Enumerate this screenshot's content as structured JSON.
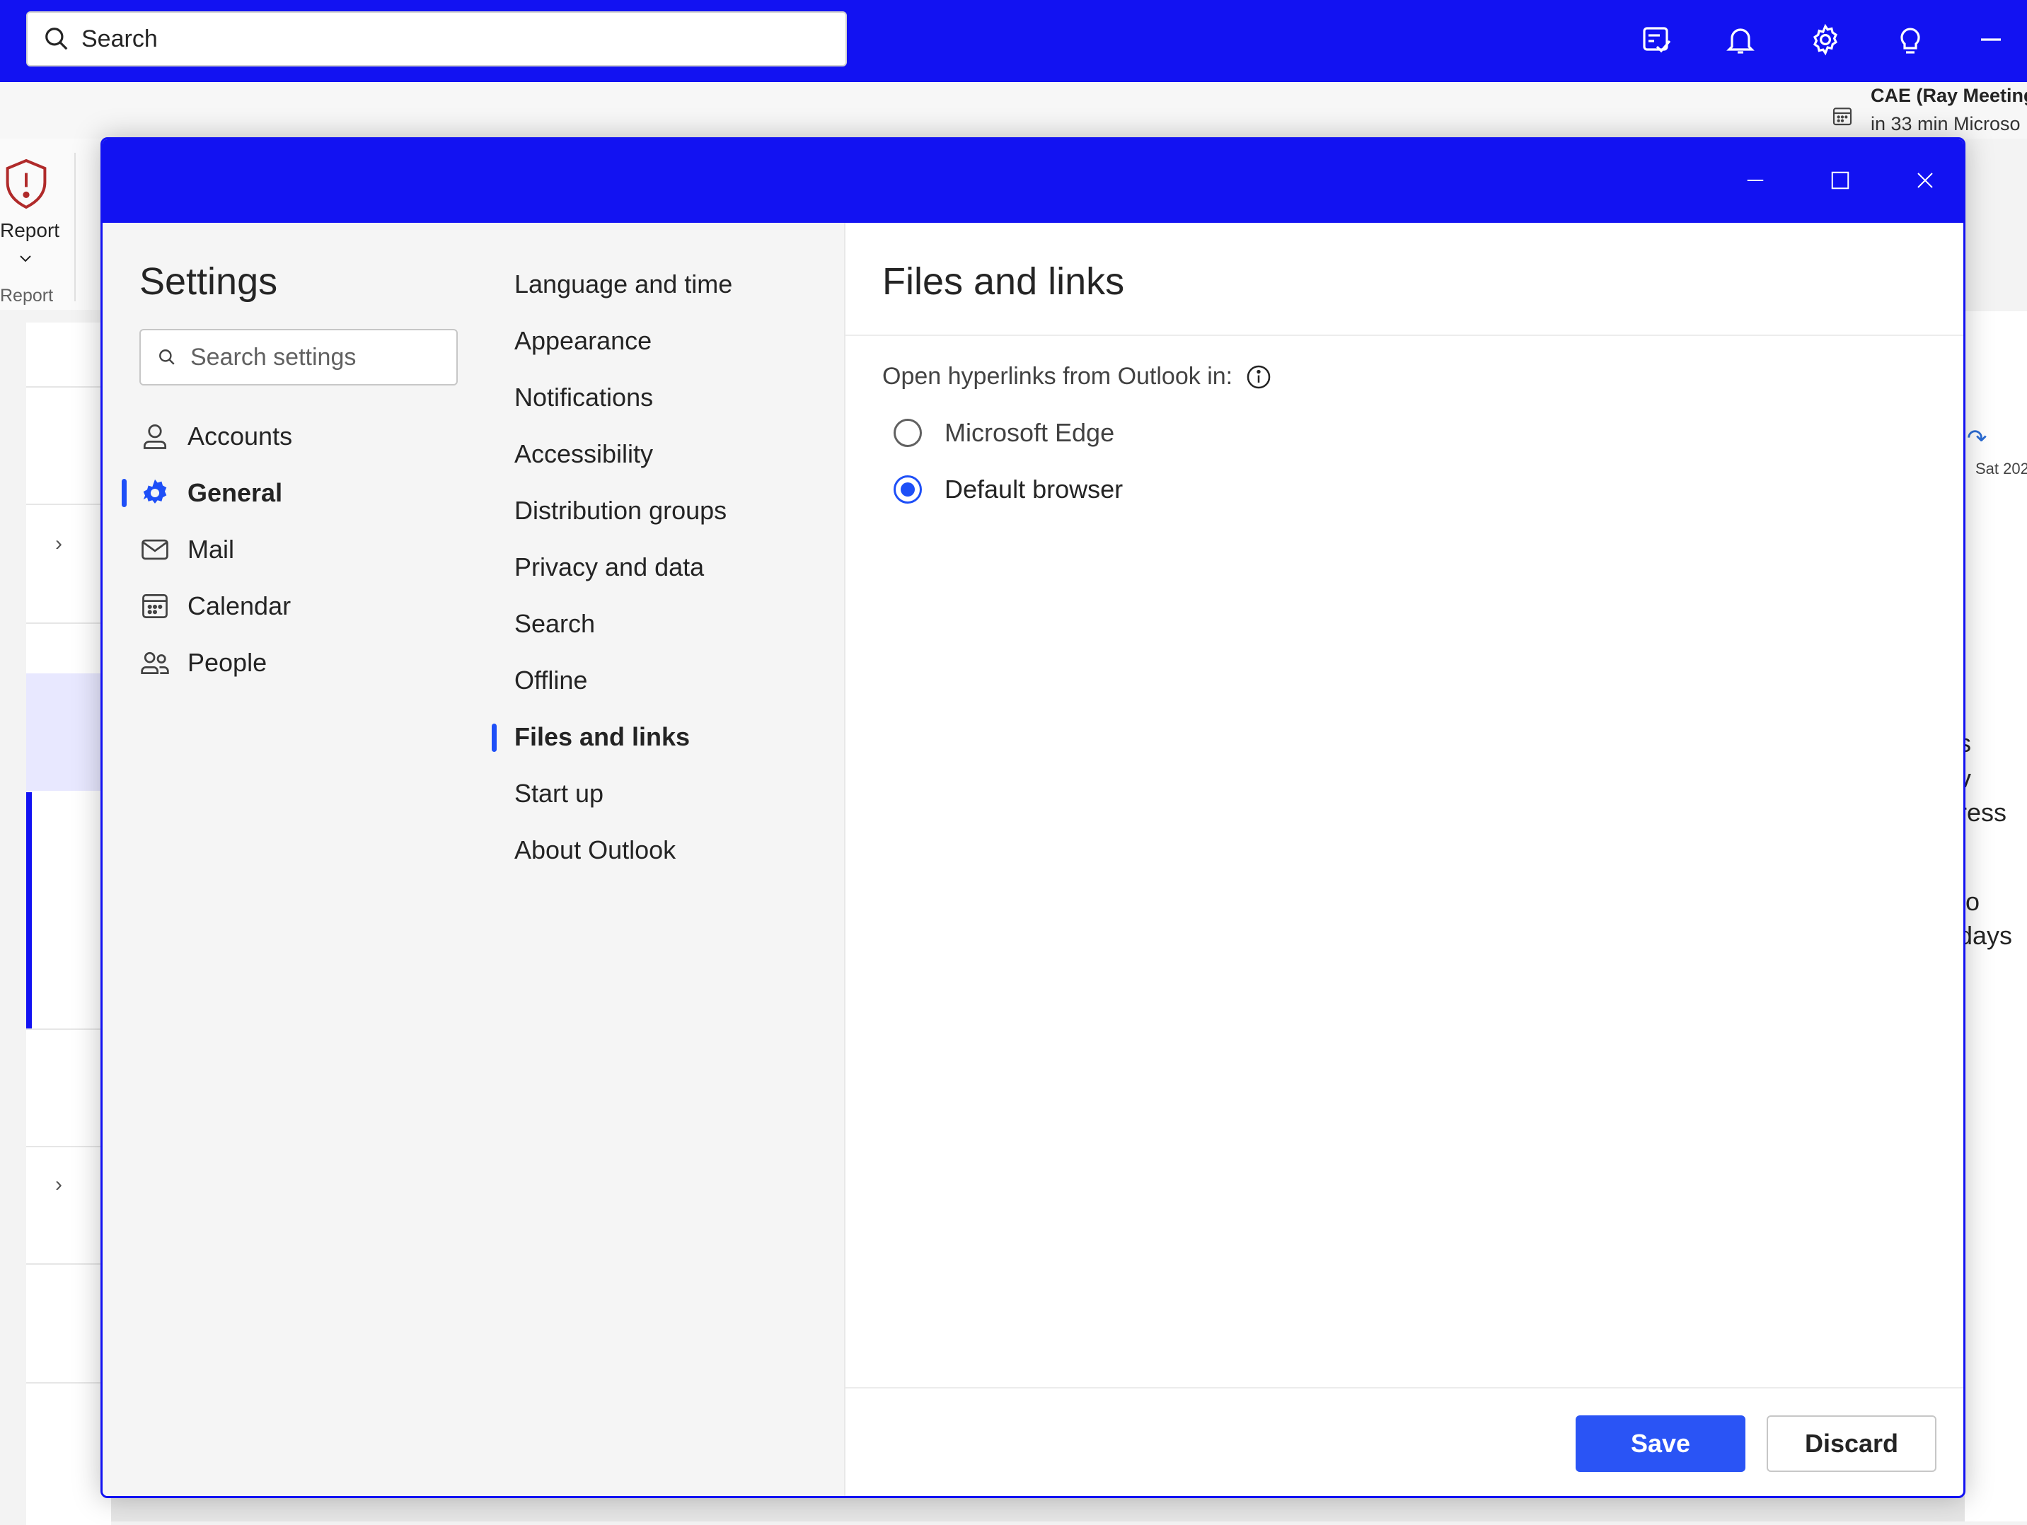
{
  "topbar": {
    "search_placeholder": "Search",
    "icons": [
      "tasks-check-icon",
      "bell-icon",
      "gear-icon",
      "lightbulb-icon",
      "minimize-icon"
    ],
    "accent": "#1212f2"
  },
  "reminder": {
    "title": "CAE (Ray Meeting",
    "subtitle": "in 33 min Microso"
  },
  "ribbon": {
    "report_label": "Report",
    "group_label": "Report"
  },
  "reading_pane": {
    "date": "Sat 202",
    "fragments": [
      "s",
      "v",
      "ress",
      "to",
      "days"
    ]
  },
  "settings": {
    "title": "Settings",
    "search_placeholder": "Search settings",
    "categories": [
      {
        "label": "Accounts",
        "icon": "person-icon",
        "active": false
      },
      {
        "label": "General",
        "icon": "gear-icon",
        "active": true
      },
      {
        "label": "Mail",
        "icon": "mail-icon",
        "active": false
      },
      {
        "label": "Calendar",
        "icon": "calendar-icon",
        "active": false
      },
      {
        "label": "People",
        "icon": "people-icon",
        "active": false
      }
    ],
    "subcategories": [
      {
        "label": "Language and time",
        "active": false
      },
      {
        "label": "Appearance",
        "active": false
      },
      {
        "label": "Notifications",
        "active": false
      },
      {
        "label": "Accessibility",
        "active": false
      },
      {
        "label": "Distribution groups",
        "active": false
      },
      {
        "label": "Privacy and data",
        "active": false
      },
      {
        "label": "Search",
        "active": false
      },
      {
        "label": "Offline",
        "active": false
      },
      {
        "label": "Files and links",
        "active": true
      },
      {
        "label": "Start up",
        "active": false
      },
      {
        "label": "About Outlook",
        "active": false
      }
    ],
    "content": {
      "title": "Files and links",
      "hyperlink_label": "Open hyperlinks from Outlook in:",
      "options": [
        {
          "label": "Microsoft Edge",
          "checked": false
        },
        {
          "label": "Default browser",
          "checked": true
        }
      ]
    },
    "save_label": "Save",
    "discard_label": "Discard",
    "accent": "#1e4ff7"
  }
}
